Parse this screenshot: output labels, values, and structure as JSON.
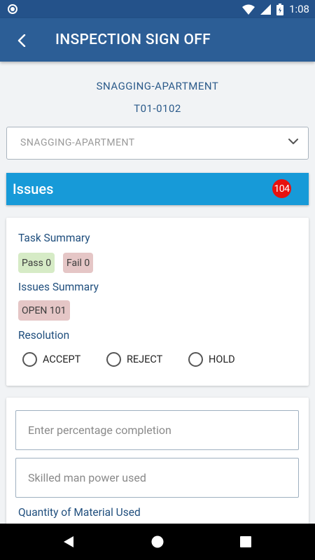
{
  "status_bar": {
    "time": "1:08",
    "icons": [
      "notification-circle-icon",
      "wifi-icon",
      "signal-icon",
      "battery-icon"
    ]
  },
  "app_bar": {
    "title": "INSPECTION SIGN OFF",
    "back_icon": "back-arrow-icon"
  },
  "header": {
    "project": "SNAGGING-APARTMENT",
    "unit": "T01-0102"
  },
  "dropdown": {
    "selected": "SNAGGING-APARTMENT",
    "icon": "chevron-down-icon"
  },
  "issues": {
    "label": "Issues",
    "count": "104",
    "colors": {
      "bar": "#179ad8",
      "badge": "#e8110f"
    }
  },
  "summary": {
    "task_title": "Task Summary",
    "pass_label": "Pass 0",
    "fail_label": "Fail 0",
    "issues_title": "Issues Summary",
    "open_label": "OPEN 101",
    "resolution_title": "Resolution",
    "options": [
      "ACCEPT",
      "REJECT",
      "HOLD"
    ]
  },
  "form": {
    "percentage_placeholder": "Enter percentage completion",
    "manpower_placeholder": "Skilled man power used",
    "material_title": "Quantity of Material Used"
  },
  "nav": {
    "icons": [
      "back-triangle-icon",
      "home-circle-icon",
      "recents-square-icon"
    ]
  }
}
